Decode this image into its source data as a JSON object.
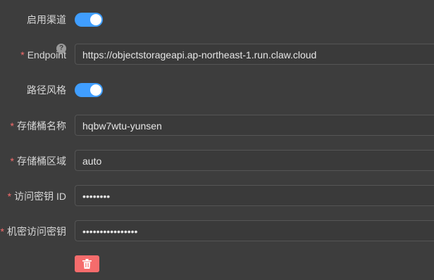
{
  "form": {
    "enable_channel": {
      "label": "启用渠道",
      "enabled": true
    },
    "endpoint": {
      "label": "Endpoint",
      "required": "*",
      "help": "?",
      "value": "https://objectstorageapi.ap-northeast-1.run.claw.cloud"
    },
    "path_style": {
      "label": "路径风格",
      "enabled": true
    },
    "bucket_name": {
      "label": "存储桶名称",
      "required": "*",
      "value": "hqbw7wtu-yunsen"
    },
    "bucket_region": {
      "label": "存储桶区域",
      "required": "*",
      "value": "auto"
    },
    "access_key_id": {
      "label": "访问密钥 ID",
      "required": "*",
      "value": "••••••••"
    },
    "secret_access_key": {
      "label": "机密访问密钥",
      "required": "*",
      "value": "••••••••••••••••"
    }
  },
  "colors": {
    "accent": "#409eff",
    "danger": "#f56c6c",
    "background": "#3d3d3d"
  },
  "icons": {
    "help": "question-circle-icon",
    "delete": "trash-icon"
  }
}
